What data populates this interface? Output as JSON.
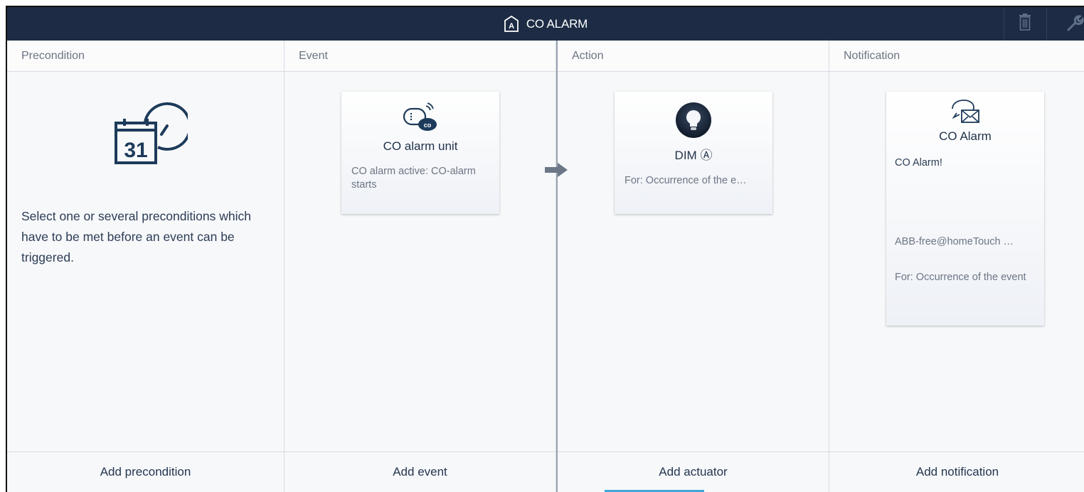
{
  "header": {
    "title": "CO ALARM",
    "title_icon": "scene-a-icon",
    "delete_icon": "trash-icon",
    "settings_icon": "wrench-icon"
  },
  "columns": [
    {
      "heading": "Precondition",
      "footer": "Add precondition",
      "hint": "Select one or several preconditions which have to be met before an event can be triggered.",
      "hint_icon": "calendar-clock-icon"
    },
    {
      "heading": "Event",
      "footer": "Add event",
      "card": {
        "icon": "co-alarm-icon",
        "title": "CO alarm unit",
        "description": "CO alarm active: CO-alarm starts"
      }
    },
    {
      "heading": "Action",
      "footer": "Add actuator",
      "card": {
        "icon": "light-bulb-icon",
        "title": "DIM",
        "title_badge": "Ⓐ",
        "description": "For: Occurrence of the e…"
      }
    },
    {
      "heading": "Notification",
      "footer": "Add notification",
      "card": {
        "icon": "message-envelope-icon",
        "title": "CO Alarm",
        "message": "CO Alarm!",
        "recipient": "ABB-free@homeTouch …",
        "description": "For: Occurrence of the event"
      }
    }
  ],
  "colors": {
    "header_bg": "#1d2c44",
    "icon_dark": "#1d3a5a",
    "accent": "#3fa8d8"
  }
}
